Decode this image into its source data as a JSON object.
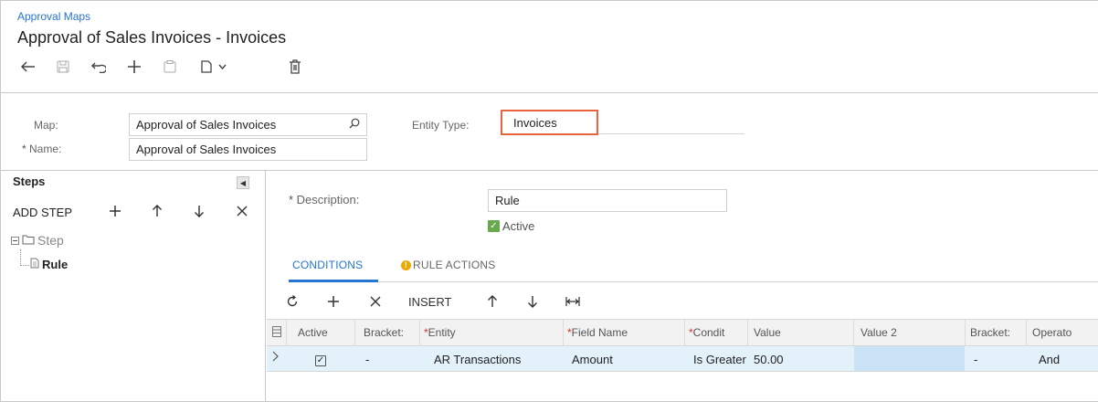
{
  "header": {
    "breadcrumb": "Approval Maps",
    "title": "Approval of Sales Invoices - Invoices"
  },
  "toolbar": {
    "icons": [
      "back-arrow-icon",
      "save-icon",
      "undo-icon",
      "add-icon",
      "copy-icon",
      "paste-icon",
      "delete-icon"
    ]
  },
  "form": {
    "map_label": "Map:",
    "map_value": "Approval of Sales Invoices",
    "name_label": "Name:",
    "name_value": "Approval of Sales Invoices",
    "entity_type_label": "Entity Type:",
    "entity_type_value": "Invoices",
    "entity_type_highlight": "#e8643c"
  },
  "steps": {
    "title": "Steps",
    "add_step_label": "ADD STEP",
    "tree": {
      "step_label": "Step",
      "rule_label": "Rule"
    }
  },
  "rule": {
    "description_label": "Description:",
    "description_value": "Rule",
    "active_label": "Active",
    "active_checked": true
  },
  "tabs": [
    {
      "label": "CONDITIONS",
      "active": true
    },
    {
      "label": "RULE ACTIONS",
      "active": false,
      "warning": true
    }
  ],
  "grid_toolbar": {
    "insert_label": "INSERT"
  },
  "grid": {
    "columns": [
      "Active",
      "Bracket:",
      "Entity",
      "Field Name",
      "Condit",
      "Value",
      "Value 2",
      "Bracket:",
      "Operato"
    ],
    "required_columns": [
      "Entity",
      "Field Name",
      "Condit"
    ],
    "rows": [
      {
        "active": true,
        "bracket_open": "-",
        "entity": "AR Transactions",
        "field_name": "Amount",
        "condition": "Is Greater",
        "value": "50.00",
        "value2": "",
        "bracket_close": "-",
        "operator": "And"
      }
    ]
  },
  "colors": {
    "accent": "#2575d1",
    "row_selected": "#e3f1fb",
    "checkbox_active": "#6aa84f",
    "warning": "#f0a800"
  }
}
